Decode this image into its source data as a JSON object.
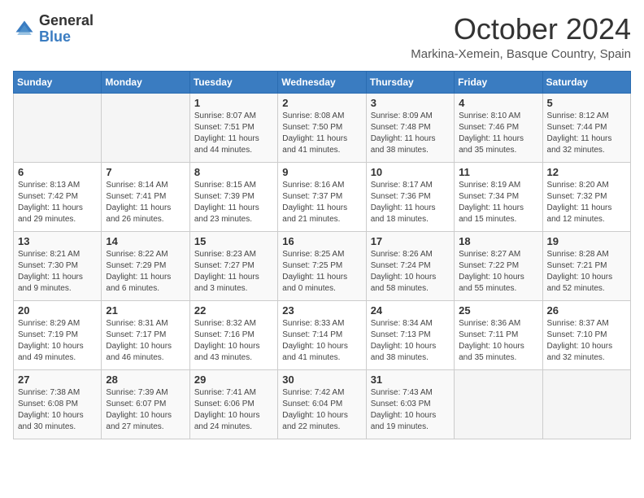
{
  "header": {
    "logo_general": "General",
    "logo_blue": "Blue",
    "month_title": "October 2024",
    "location": "Markina-Xemein, Basque Country, Spain"
  },
  "weekdays": [
    "Sunday",
    "Monday",
    "Tuesday",
    "Wednesday",
    "Thursday",
    "Friday",
    "Saturday"
  ],
  "weeks": [
    [
      {
        "day": "",
        "detail": ""
      },
      {
        "day": "",
        "detail": ""
      },
      {
        "day": "1",
        "detail": "Sunrise: 8:07 AM\nSunset: 7:51 PM\nDaylight: 11 hours and 44 minutes."
      },
      {
        "day": "2",
        "detail": "Sunrise: 8:08 AM\nSunset: 7:50 PM\nDaylight: 11 hours and 41 minutes."
      },
      {
        "day": "3",
        "detail": "Sunrise: 8:09 AM\nSunset: 7:48 PM\nDaylight: 11 hours and 38 minutes."
      },
      {
        "day": "4",
        "detail": "Sunrise: 8:10 AM\nSunset: 7:46 PM\nDaylight: 11 hours and 35 minutes."
      },
      {
        "day": "5",
        "detail": "Sunrise: 8:12 AM\nSunset: 7:44 PM\nDaylight: 11 hours and 32 minutes."
      }
    ],
    [
      {
        "day": "6",
        "detail": "Sunrise: 8:13 AM\nSunset: 7:42 PM\nDaylight: 11 hours and 29 minutes."
      },
      {
        "day": "7",
        "detail": "Sunrise: 8:14 AM\nSunset: 7:41 PM\nDaylight: 11 hours and 26 minutes."
      },
      {
        "day": "8",
        "detail": "Sunrise: 8:15 AM\nSunset: 7:39 PM\nDaylight: 11 hours and 23 minutes."
      },
      {
        "day": "9",
        "detail": "Sunrise: 8:16 AM\nSunset: 7:37 PM\nDaylight: 11 hours and 21 minutes."
      },
      {
        "day": "10",
        "detail": "Sunrise: 8:17 AM\nSunset: 7:36 PM\nDaylight: 11 hours and 18 minutes."
      },
      {
        "day": "11",
        "detail": "Sunrise: 8:19 AM\nSunset: 7:34 PM\nDaylight: 11 hours and 15 minutes."
      },
      {
        "day": "12",
        "detail": "Sunrise: 8:20 AM\nSunset: 7:32 PM\nDaylight: 11 hours and 12 minutes."
      }
    ],
    [
      {
        "day": "13",
        "detail": "Sunrise: 8:21 AM\nSunset: 7:30 PM\nDaylight: 11 hours and 9 minutes."
      },
      {
        "day": "14",
        "detail": "Sunrise: 8:22 AM\nSunset: 7:29 PM\nDaylight: 11 hours and 6 minutes."
      },
      {
        "day": "15",
        "detail": "Sunrise: 8:23 AM\nSunset: 7:27 PM\nDaylight: 11 hours and 3 minutes."
      },
      {
        "day": "16",
        "detail": "Sunrise: 8:25 AM\nSunset: 7:25 PM\nDaylight: 11 hours and 0 minutes."
      },
      {
        "day": "17",
        "detail": "Sunrise: 8:26 AM\nSunset: 7:24 PM\nDaylight: 10 hours and 58 minutes."
      },
      {
        "day": "18",
        "detail": "Sunrise: 8:27 AM\nSunset: 7:22 PM\nDaylight: 10 hours and 55 minutes."
      },
      {
        "day": "19",
        "detail": "Sunrise: 8:28 AM\nSunset: 7:21 PM\nDaylight: 10 hours and 52 minutes."
      }
    ],
    [
      {
        "day": "20",
        "detail": "Sunrise: 8:29 AM\nSunset: 7:19 PM\nDaylight: 10 hours and 49 minutes."
      },
      {
        "day": "21",
        "detail": "Sunrise: 8:31 AM\nSunset: 7:17 PM\nDaylight: 10 hours and 46 minutes."
      },
      {
        "day": "22",
        "detail": "Sunrise: 8:32 AM\nSunset: 7:16 PM\nDaylight: 10 hours and 43 minutes."
      },
      {
        "day": "23",
        "detail": "Sunrise: 8:33 AM\nSunset: 7:14 PM\nDaylight: 10 hours and 41 minutes."
      },
      {
        "day": "24",
        "detail": "Sunrise: 8:34 AM\nSunset: 7:13 PM\nDaylight: 10 hours and 38 minutes."
      },
      {
        "day": "25",
        "detail": "Sunrise: 8:36 AM\nSunset: 7:11 PM\nDaylight: 10 hours and 35 minutes."
      },
      {
        "day": "26",
        "detail": "Sunrise: 8:37 AM\nSunset: 7:10 PM\nDaylight: 10 hours and 32 minutes."
      }
    ],
    [
      {
        "day": "27",
        "detail": "Sunrise: 7:38 AM\nSunset: 6:08 PM\nDaylight: 10 hours and 30 minutes."
      },
      {
        "day": "28",
        "detail": "Sunrise: 7:39 AM\nSunset: 6:07 PM\nDaylight: 10 hours and 27 minutes."
      },
      {
        "day": "29",
        "detail": "Sunrise: 7:41 AM\nSunset: 6:06 PM\nDaylight: 10 hours and 24 minutes."
      },
      {
        "day": "30",
        "detail": "Sunrise: 7:42 AM\nSunset: 6:04 PM\nDaylight: 10 hours and 22 minutes."
      },
      {
        "day": "31",
        "detail": "Sunrise: 7:43 AM\nSunset: 6:03 PM\nDaylight: 10 hours and 19 minutes."
      },
      {
        "day": "",
        "detail": ""
      },
      {
        "day": "",
        "detail": ""
      }
    ]
  ]
}
